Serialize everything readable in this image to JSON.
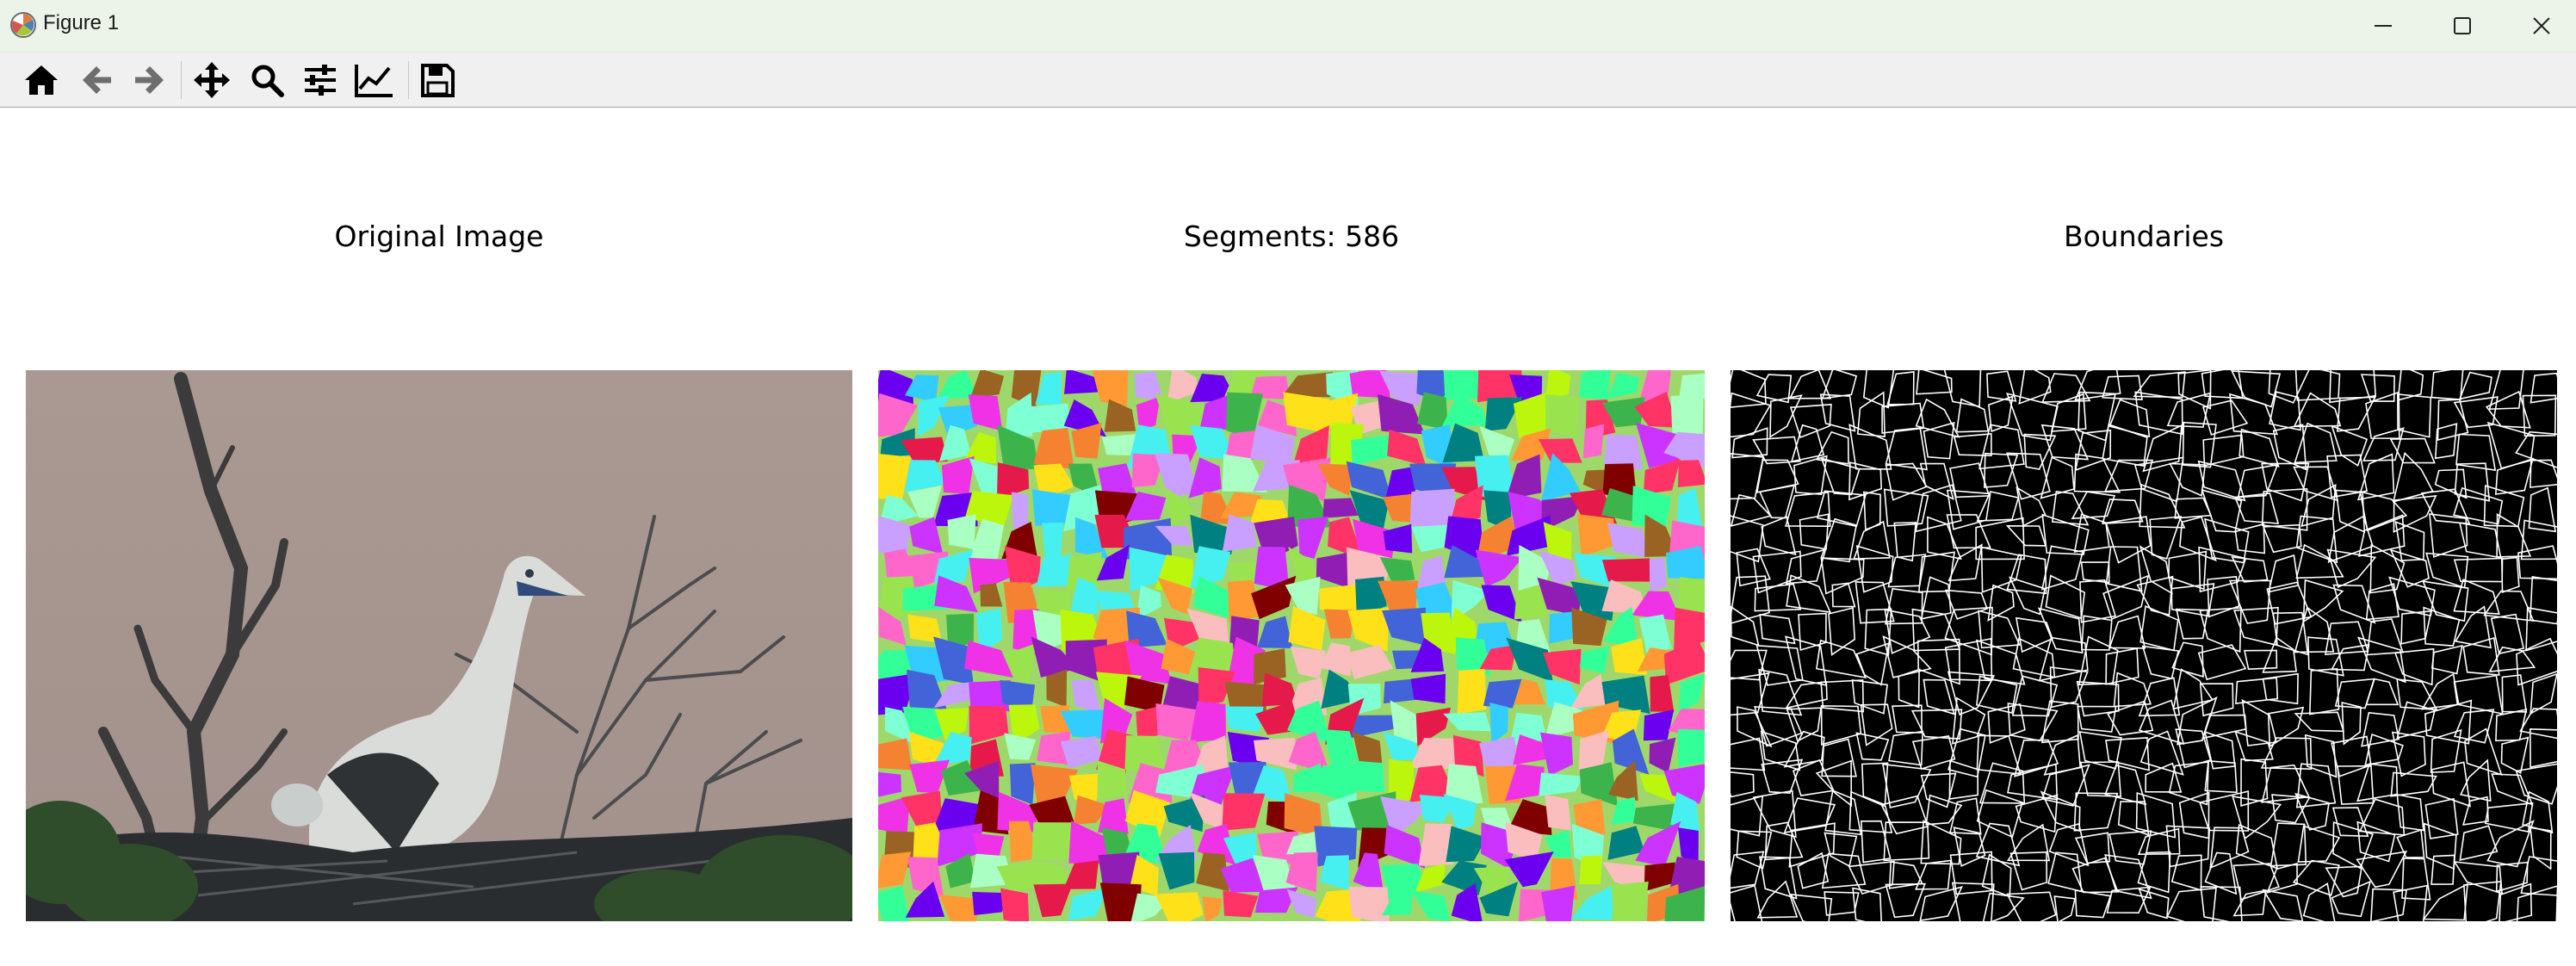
{
  "window": {
    "title": "Figure 1"
  },
  "toolbar": {
    "buttons": [
      {
        "name": "home-button",
        "icon": "home-icon"
      },
      {
        "name": "back-button",
        "icon": "arrow-left-icon"
      },
      {
        "name": "forward-button",
        "icon": "arrow-right-icon"
      },
      {
        "name": "pan-button",
        "icon": "move-arrows-icon"
      },
      {
        "name": "zoom-button",
        "icon": "magnifier-icon"
      },
      {
        "name": "configure-subplots-button",
        "icon": "sliders-icon"
      },
      {
        "name": "edit-axes-button",
        "icon": "line-chart-icon"
      },
      {
        "name": "save-button",
        "icon": "floppy-disk-icon"
      }
    ]
  },
  "figure": {
    "axes": [
      {
        "title": "Original Image",
        "content": "photo of a white seabird with chick on a twig nest"
      },
      {
        "title": "Segments: 586",
        "content": "colored superpixel segmentation map"
      },
      {
        "title": "Boundaries",
        "content": "white segment boundaries on black"
      }
    ]
  },
  "colors": {
    "titlebar_bg": "#ecf4ea",
    "toolbar_bg": "#f0f0f0",
    "icon": "#000000",
    "boundary_bg": "#000000",
    "boundary_line": "#ffffff"
  }
}
